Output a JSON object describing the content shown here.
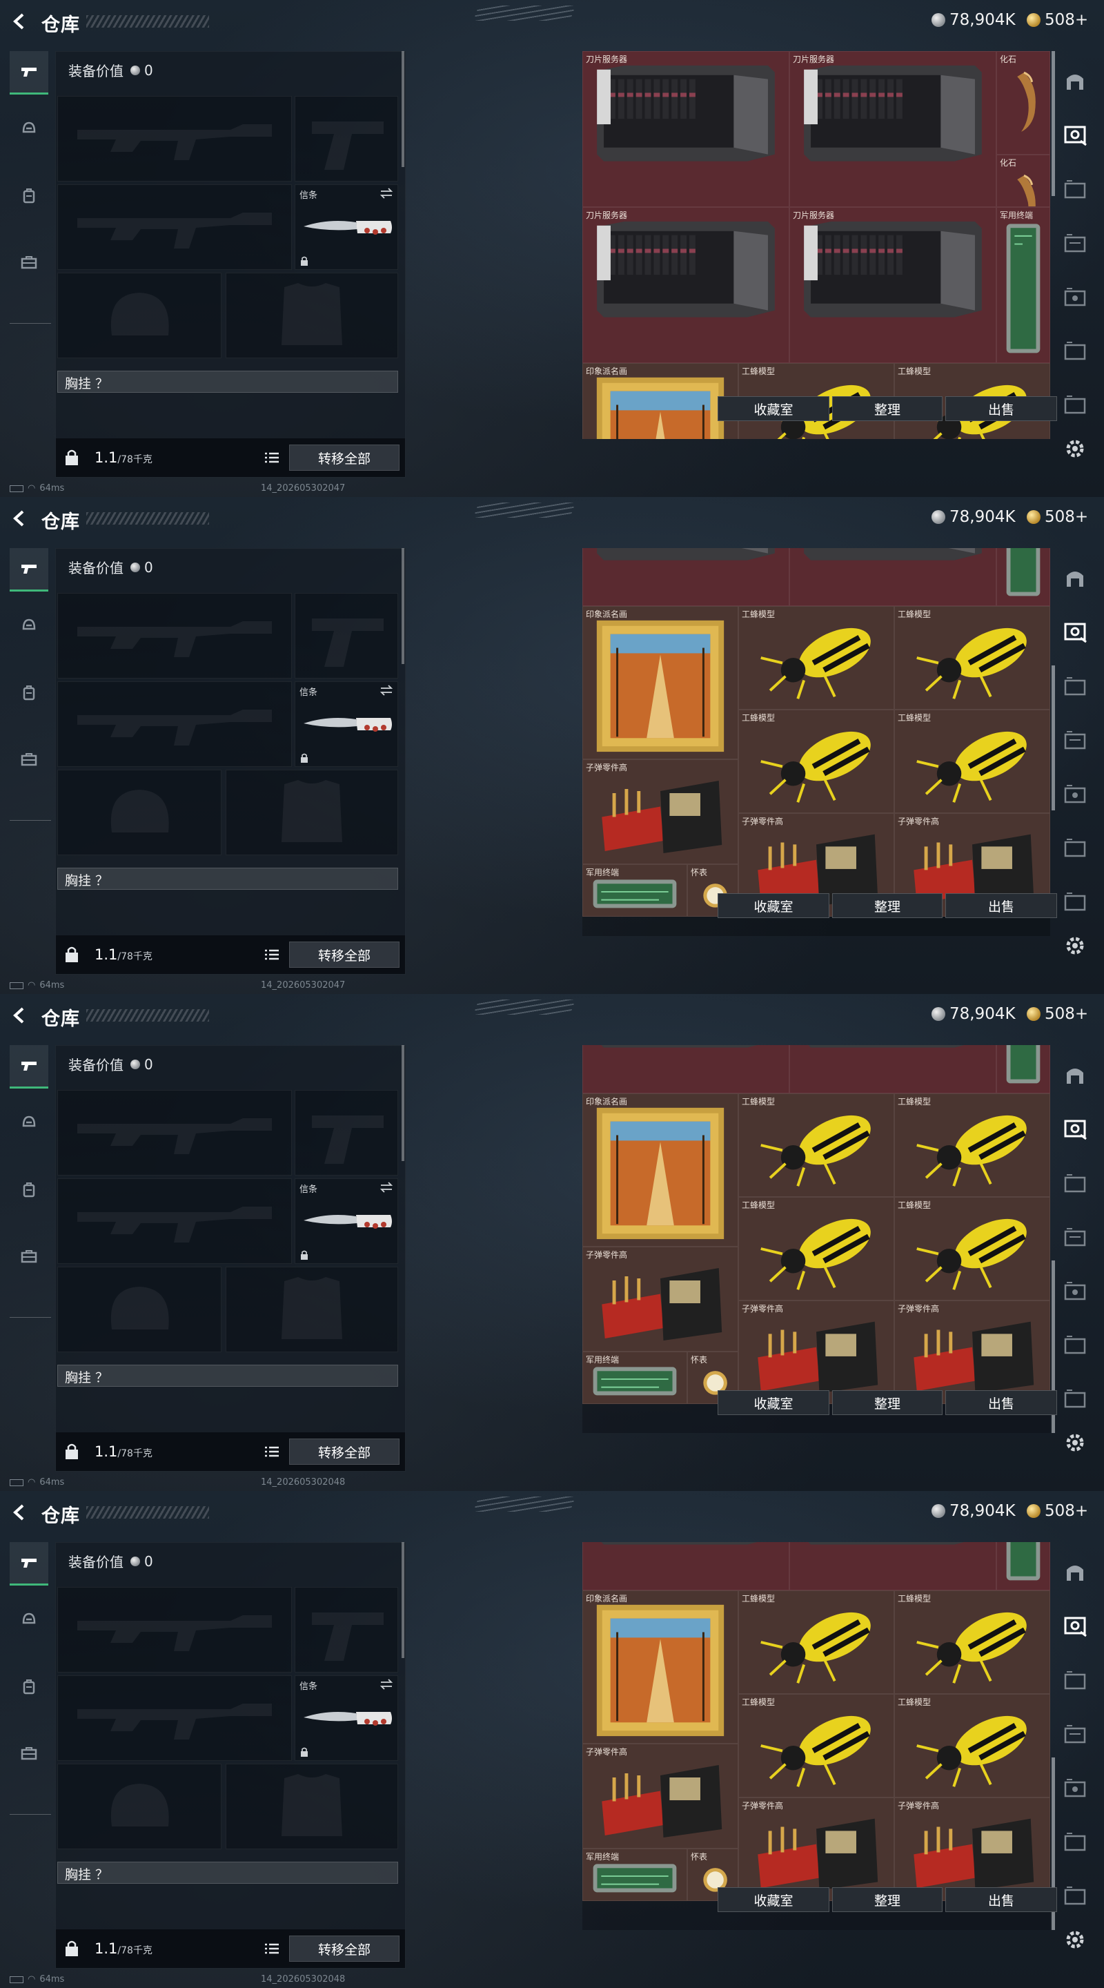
{
  "header": {
    "title": "仓库",
    "silver_amount": "78,904K",
    "gold_amount": "508+"
  },
  "equipment": {
    "value_label": "装备价值",
    "value_amount": "0",
    "melee_label": "信条",
    "chest_rig_label": "胸挂 ？",
    "weight_value": "1.1",
    "weight_max": "/78千克",
    "move_all_label": "转移全部"
  },
  "stash_actions": {
    "collection_label": "收藏室",
    "sort_label": "整理",
    "sell_label": "出售"
  },
  "status": {
    "ping": "64ms"
  },
  "frames": [
    {
      "uid": "14_202605302047",
      "scroll_label": "top"
    },
    {
      "uid": "14_202605302047",
      "scroll_label": "middle"
    },
    {
      "uid": "14_202605302048",
      "scroll_label": "bottom"
    },
    {
      "uid": "14_202605302048",
      "scroll_label": "bottom"
    }
  ],
  "items": {
    "blade_server": "刀片服务器",
    "fossil": "化石",
    "military_terminal": "军用终端",
    "impressionist_painting": "印象派名画",
    "worker_bee_model": "工蜂模型",
    "bullet_parts_high": "子弹零件高",
    "pocket_watch": "怀表"
  },
  "colors": {
    "accent_green": "#3fb87a",
    "stash_red": "#5a2a30",
    "stash_brown": "#4a3530",
    "bee_yellow": "#e8d21e"
  }
}
